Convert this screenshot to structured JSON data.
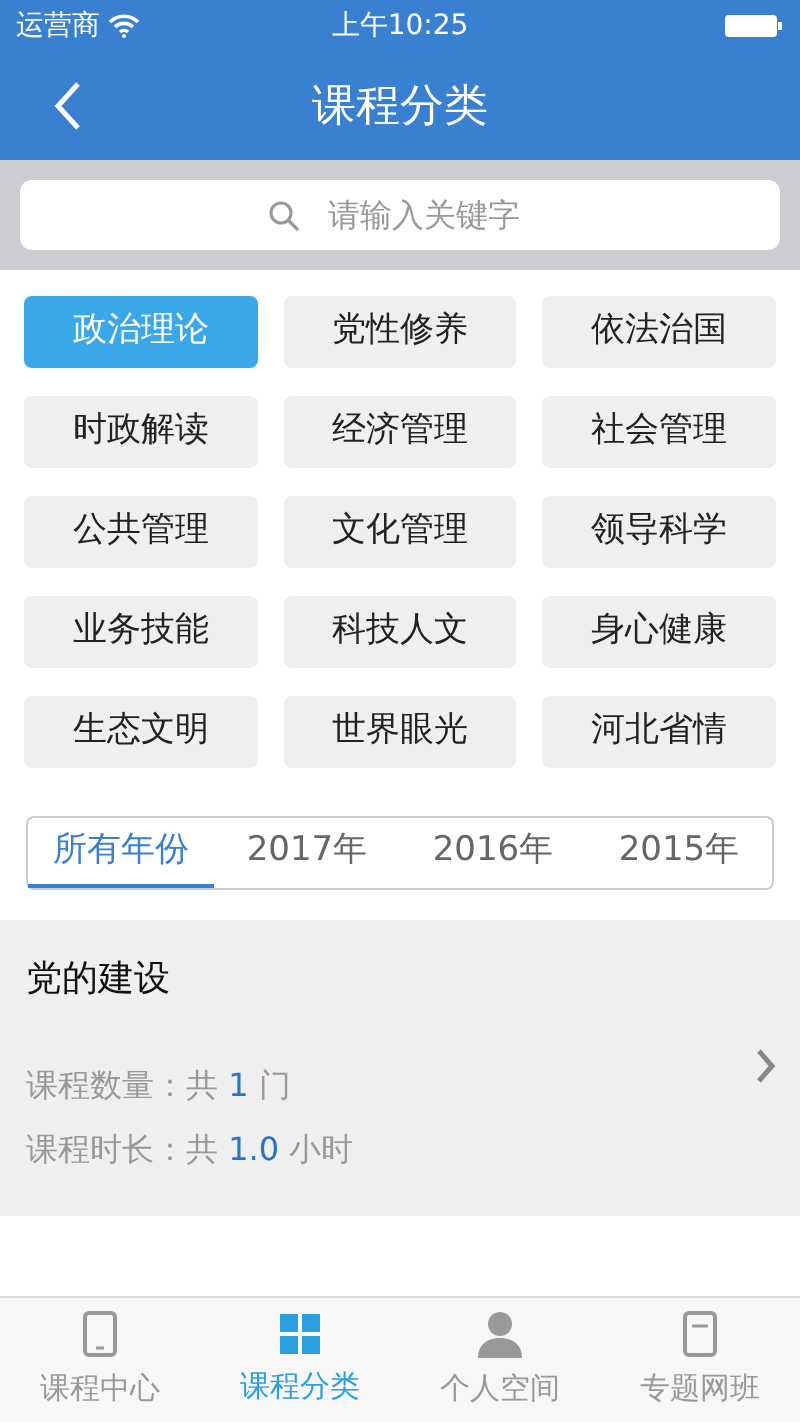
{
  "status_bar": {
    "carrier": "运营商",
    "time": "上午10:25"
  },
  "nav": {
    "title": "课程分类"
  },
  "search": {
    "placeholder": "请输入关键字"
  },
  "categories": [
    {
      "label": "政治理论",
      "selected": true
    },
    {
      "label": "党性修养",
      "selected": false
    },
    {
      "label": "依法治国",
      "selected": false
    },
    {
      "label": "时政解读",
      "selected": false
    },
    {
      "label": "经济管理",
      "selected": false
    },
    {
      "label": "社会管理",
      "selected": false
    },
    {
      "label": "公共管理",
      "selected": false
    },
    {
      "label": "文化管理",
      "selected": false
    },
    {
      "label": "领导科学",
      "selected": false
    },
    {
      "label": "业务技能",
      "selected": false
    },
    {
      "label": "科技人文",
      "selected": false
    },
    {
      "label": "身心健康",
      "selected": false
    },
    {
      "label": "生态文明",
      "selected": false
    },
    {
      "label": "世界眼光",
      "selected": false
    },
    {
      "label": "河北省情",
      "selected": false
    }
  ],
  "year_tabs": [
    {
      "label": "所有年份",
      "selected": true
    },
    {
      "label": "2017年",
      "selected": false
    },
    {
      "label": "2016年",
      "selected": false
    },
    {
      "label": "2015年",
      "selected": false
    }
  ],
  "courses": [
    {
      "title": "党的建设",
      "count_label": "课程数量：",
      "count_pre": "共",
      "count_value": "1",
      "count_unit": "门",
      "duration_label": "课程时长：",
      "duration_pre": "共",
      "duration_value": "1.0",
      "duration_unit": "小时"
    }
  ],
  "tab_bar": [
    {
      "label": "课程中心",
      "selected": false
    },
    {
      "label": "课程分类",
      "selected": true
    },
    {
      "label": "个人空间",
      "selected": false
    },
    {
      "label": "专题网班",
      "selected": false
    }
  ]
}
